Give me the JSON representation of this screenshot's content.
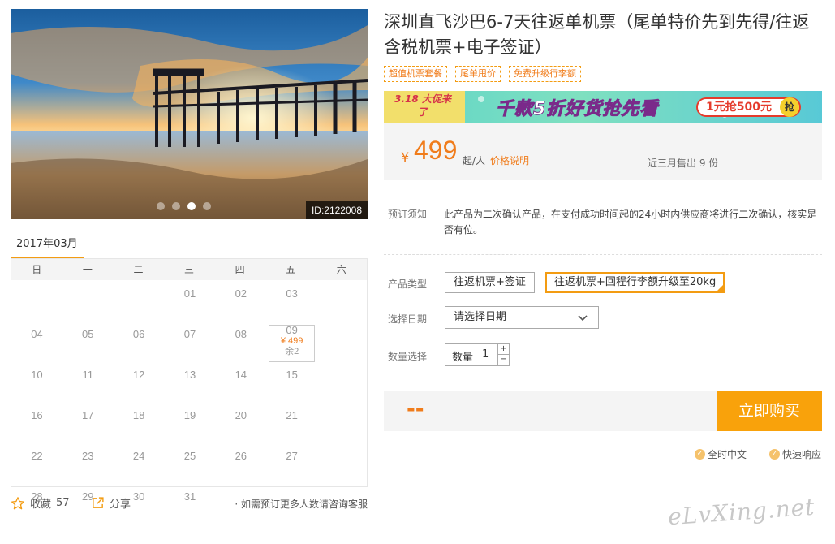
{
  "gallery": {
    "image_id": "ID:2122008",
    "dot_count": 4,
    "active_dot": 2
  },
  "calendar": {
    "month_label": "2017年03月",
    "weekdays": [
      "日",
      "一",
      "二",
      "三",
      "四",
      "五",
      "六"
    ],
    "weeks": [
      [
        "",
        "",
        "",
        "01",
        "02",
        "03",
        "04"
      ],
      [
        "05",
        "06",
        "07",
        "08",
        "09",
        "10",
        "11"
      ],
      [
        "12",
        "13",
        "14",
        "15",
        "16",
        "17",
        "18"
      ],
      [
        "19",
        "20",
        "21",
        "22",
        "23",
        "24",
        "25"
      ],
      [
        "26",
        "27",
        "28",
        "29",
        "30",
        "31",
        ""
      ]
    ],
    "available": {
      "day": "09",
      "price": "¥ 499",
      "stock": "余2"
    }
  },
  "footer": {
    "fav_label": "收藏",
    "fav_count": "57",
    "share_label": "分享",
    "consult_note": "· 如需预订更多人数请咨询客服"
  },
  "product": {
    "title": "深圳直飞沙巴6-7天往返单机票（尾单特价先到先得/往返含税机票+电子签证）",
    "tags": [
      "超值机票套餐",
      "尾单甩价",
      "免费升级行李额"
    ]
  },
  "banner": {
    "left_text": "3.18 大促来了",
    "mid_text": "千款5折好货抢先看",
    "right_text": "1元抢500元",
    "grab_text": "抢"
  },
  "price": {
    "currency": "¥",
    "value": "499",
    "unit": "起/人",
    "explain_link": "价格说明",
    "sold_text": "近三月售出 9 份"
  },
  "notice": {
    "label": "预订须知",
    "text": "此产品为二次确认产品，在支付成功时间起的24小时内供应商将进行二次确认，核实是否有位。"
  },
  "options": {
    "type_label": "产品类型",
    "types": [
      "往返机票+签证",
      "往返机票+回程行李额升级至20kg"
    ],
    "selected_type": 1,
    "date_label": "选择日期",
    "date_placeholder": "请选择日期",
    "qty_label": "数量选择",
    "qty_prefix": "数量",
    "qty_value": "1",
    "plus": "+",
    "minus": "−"
  },
  "purchase": {
    "total": "--",
    "buy_label": "立即购买"
  },
  "assurances": [
    "全时中文",
    "快速响应"
  ],
  "watermark": "eLvXing.net",
  "colors": {
    "accent": "#f9a20b",
    "price": "#f07c1b"
  }
}
